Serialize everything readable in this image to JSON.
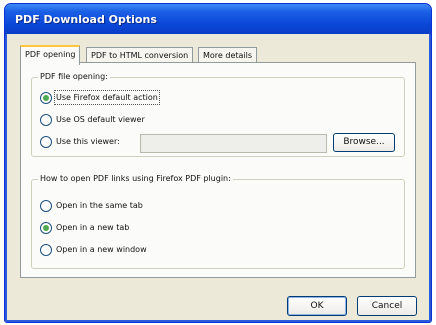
{
  "window": {
    "title": "PDF Download Options"
  },
  "tabs": [
    {
      "label": "PDF opening",
      "active": true
    },
    {
      "label": "PDF to HTML conversion",
      "active": false
    },
    {
      "label": "More details",
      "active": false
    }
  ],
  "file_opening": {
    "legend": "PDF file opening:",
    "options": [
      {
        "label": "Use Firefox default action",
        "selected": true
      },
      {
        "label": "Use OS default viewer",
        "selected": false
      },
      {
        "label": "Use this viewer:",
        "selected": false
      }
    ],
    "viewer_path": "",
    "browse_label": "Browse..."
  },
  "link_opening": {
    "legend": "How to open PDF links using Firefox PDF plugin:",
    "options": [
      {
        "label": "Open in the same tab",
        "selected": false
      },
      {
        "label": "Open in a new tab",
        "selected": true
      },
      {
        "label": "Open in a new window",
        "selected": false
      }
    ]
  },
  "buttons": {
    "ok": "OK",
    "cancel": "Cancel"
  },
  "colors": {
    "title_bar": "#0a46d6",
    "tab_highlight": "#ffc73c",
    "radio_selected": "#4fa84f",
    "dialog_bg": "#ece9d8"
  }
}
